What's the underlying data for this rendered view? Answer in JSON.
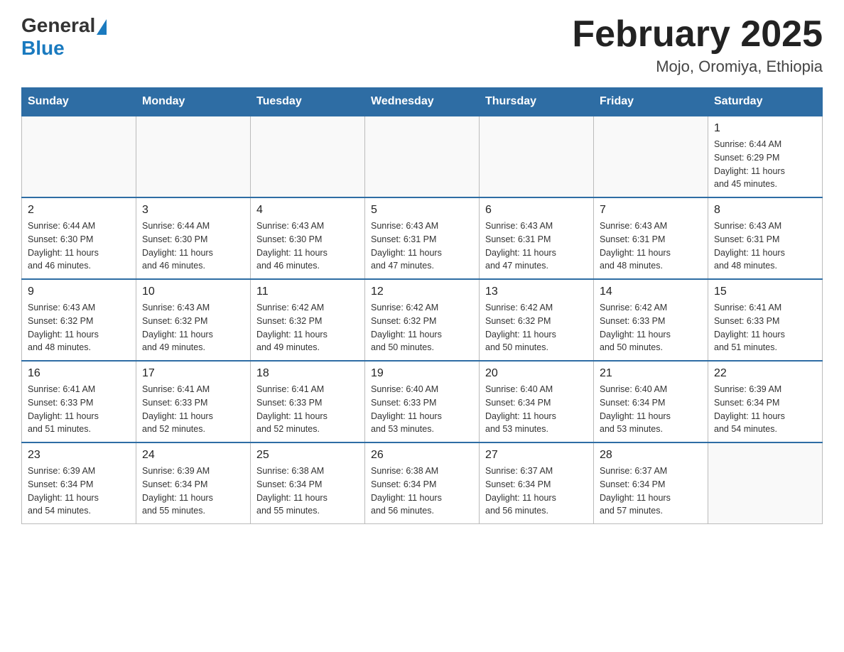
{
  "logo": {
    "general": "General",
    "blue": "Blue"
  },
  "header": {
    "month_year": "February 2025",
    "location": "Mojo, Oromiya, Ethiopia"
  },
  "weekdays": [
    "Sunday",
    "Monday",
    "Tuesday",
    "Wednesday",
    "Thursday",
    "Friday",
    "Saturday"
  ],
  "weeks": [
    [
      {
        "day": "",
        "info": ""
      },
      {
        "day": "",
        "info": ""
      },
      {
        "day": "",
        "info": ""
      },
      {
        "day": "",
        "info": ""
      },
      {
        "day": "",
        "info": ""
      },
      {
        "day": "",
        "info": ""
      },
      {
        "day": "1",
        "info": "Sunrise: 6:44 AM\nSunset: 6:29 PM\nDaylight: 11 hours\nand 45 minutes."
      }
    ],
    [
      {
        "day": "2",
        "info": "Sunrise: 6:44 AM\nSunset: 6:30 PM\nDaylight: 11 hours\nand 46 minutes."
      },
      {
        "day": "3",
        "info": "Sunrise: 6:44 AM\nSunset: 6:30 PM\nDaylight: 11 hours\nand 46 minutes."
      },
      {
        "day": "4",
        "info": "Sunrise: 6:43 AM\nSunset: 6:30 PM\nDaylight: 11 hours\nand 46 minutes."
      },
      {
        "day": "5",
        "info": "Sunrise: 6:43 AM\nSunset: 6:31 PM\nDaylight: 11 hours\nand 47 minutes."
      },
      {
        "day": "6",
        "info": "Sunrise: 6:43 AM\nSunset: 6:31 PM\nDaylight: 11 hours\nand 47 minutes."
      },
      {
        "day": "7",
        "info": "Sunrise: 6:43 AM\nSunset: 6:31 PM\nDaylight: 11 hours\nand 48 minutes."
      },
      {
        "day": "8",
        "info": "Sunrise: 6:43 AM\nSunset: 6:31 PM\nDaylight: 11 hours\nand 48 minutes."
      }
    ],
    [
      {
        "day": "9",
        "info": "Sunrise: 6:43 AM\nSunset: 6:32 PM\nDaylight: 11 hours\nand 48 minutes."
      },
      {
        "day": "10",
        "info": "Sunrise: 6:43 AM\nSunset: 6:32 PM\nDaylight: 11 hours\nand 49 minutes."
      },
      {
        "day": "11",
        "info": "Sunrise: 6:42 AM\nSunset: 6:32 PM\nDaylight: 11 hours\nand 49 minutes."
      },
      {
        "day": "12",
        "info": "Sunrise: 6:42 AM\nSunset: 6:32 PM\nDaylight: 11 hours\nand 50 minutes."
      },
      {
        "day": "13",
        "info": "Sunrise: 6:42 AM\nSunset: 6:32 PM\nDaylight: 11 hours\nand 50 minutes."
      },
      {
        "day": "14",
        "info": "Sunrise: 6:42 AM\nSunset: 6:33 PM\nDaylight: 11 hours\nand 50 minutes."
      },
      {
        "day": "15",
        "info": "Sunrise: 6:41 AM\nSunset: 6:33 PM\nDaylight: 11 hours\nand 51 minutes."
      }
    ],
    [
      {
        "day": "16",
        "info": "Sunrise: 6:41 AM\nSunset: 6:33 PM\nDaylight: 11 hours\nand 51 minutes."
      },
      {
        "day": "17",
        "info": "Sunrise: 6:41 AM\nSunset: 6:33 PM\nDaylight: 11 hours\nand 52 minutes."
      },
      {
        "day": "18",
        "info": "Sunrise: 6:41 AM\nSunset: 6:33 PM\nDaylight: 11 hours\nand 52 minutes."
      },
      {
        "day": "19",
        "info": "Sunrise: 6:40 AM\nSunset: 6:33 PM\nDaylight: 11 hours\nand 53 minutes."
      },
      {
        "day": "20",
        "info": "Sunrise: 6:40 AM\nSunset: 6:34 PM\nDaylight: 11 hours\nand 53 minutes."
      },
      {
        "day": "21",
        "info": "Sunrise: 6:40 AM\nSunset: 6:34 PM\nDaylight: 11 hours\nand 53 minutes."
      },
      {
        "day": "22",
        "info": "Sunrise: 6:39 AM\nSunset: 6:34 PM\nDaylight: 11 hours\nand 54 minutes."
      }
    ],
    [
      {
        "day": "23",
        "info": "Sunrise: 6:39 AM\nSunset: 6:34 PM\nDaylight: 11 hours\nand 54 minutes."
      },
      {
        "day": "24",
        "info": "Sunrise: 6:39 AM\nSunset: 6:34 PM\nDaylight: 11 hours\nand 55 minutes."
      },
      {
        "day": "25",
        "info": "Sunrise: 6:38 AM\nSunset: 6:34 PM\nDaylight: 11 hours\nand 55 minutes."
      },
      {
        "day": "26",
        "info": "Sunrise: 6:38 AM\nSunset: 6:34 PM\nDaylight: 11 hours\nand 56 minutes."
      },
      {
        "day": "27",
        "info": "Sunrise: 6:37 AM\nSunset: 6:34 PM\nDaylight: 11 hours\nand 56 minutes."
      },
      {
        "day": "28",
        "info": "Sunrise: 6:37 AM\nSunset: 6:34 PM\nDaylight: 11 hours\nand 57 minutes."
      },
      {
        "day": "",
        "info": ""
      }
    ]
  ]
}
